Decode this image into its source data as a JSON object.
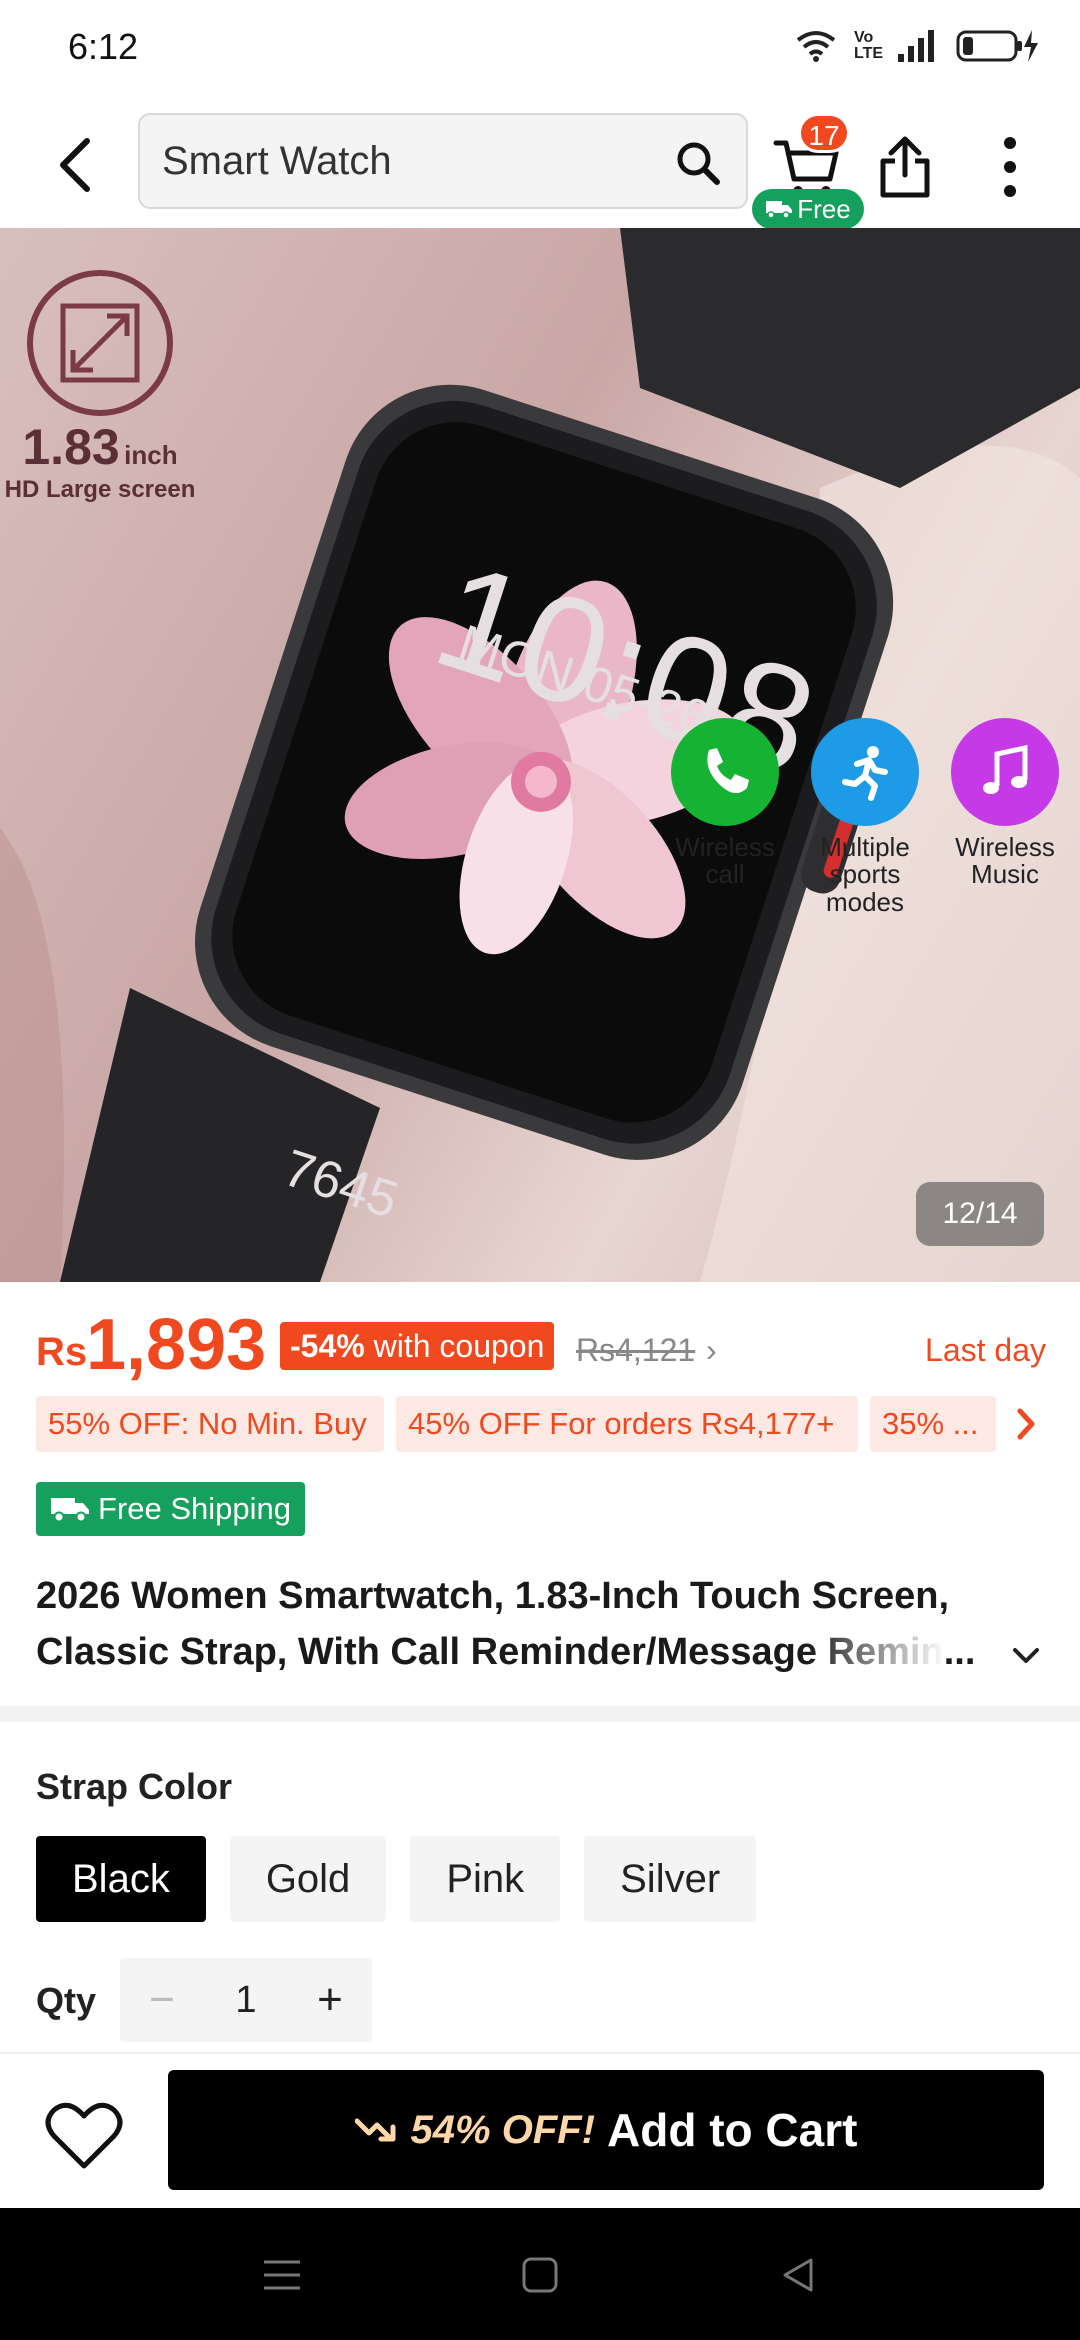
{
  "status_bar": {
    "time": "6:12",
    "network_label": "Vo LTE"
  },
  "header": {
    "search_value": "Smart Watch",
    "cart_count": "17",
    "cart_free_label": "Free"
  },
  "hero": {
    "screen_size_value": "1.83",
    "screen_size_unit": "inch",
    "screen_size_desc": "HD Large screen",
    "watch_time": "10:08",
    "watch_date": "MON 05-26",
    "watch_steps": "7645",
    "features": [
      {
        "label": "Wireless call",
        "icon": "phone-icon",
        "color": "#16b234"
      },
      {
        "label": "Multiple sports modes",
        "icon": "running-icon",
        "color": "#1e9be6"
      },
      {
        "label": "Wireless Music",
        "icon": "music-note-icon",
        "color": "#c53ae6"
      }
    ],
    "image_counter": "12/14"
  },
  "price": {
    "currency": "Rs",
    "amount": "1,893",
    "coupon_percent": "-54%",
    "coupon_text": "with coupon",
    "original": "Rs4,121",
    "deadline": "Last day"
  },
  "promos": [
    "55% OFF: No Min. Buy",
    "45% OFF For orders Rs4,177+",
    "35% ..."
  ],
  "shipping_label": "Free Shipping",
  "title": "2026 Women Smartwatch, 1.83-Inch Touch Screen, Classic Strap, With Call Reminder/Message Remin...",
  "strap": {
    "label": "Strap Color",
    "options": [
      "Black",
      "Gold",
      "Pink",
      "Silver"
    ],
    "selected": "Black"
  },
  "qty": {
    "label": "Qty",
    "value": "1",
    "minus": "−",
    "plus": "+"
  },
  "cta": {
    "discount": "54% OFF!",
    "label": "Add to Cart"
  },
  "colors": {
    "accent": "#f0491f",
    "green": "#16a05d",
    "promo_bg": "#fde9e4"
  }
}
